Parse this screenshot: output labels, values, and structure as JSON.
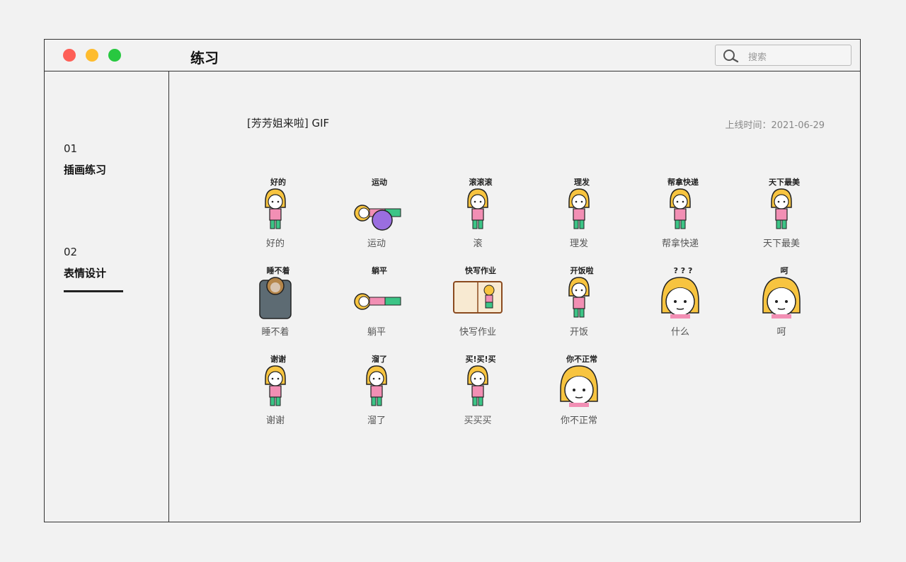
{
  "window": {
    "title": "练习",
    "search_placeholder": "搜索"
  },
  "sidebar": {
    "items": [
      {
        "num": "01",
        "label": "插画练习"
      },
      {
        "num": "02",
        "label": "表情设计"
      }
    ]
  },
  "content": {
    "title": "[芳芳姐来啦]  GIF",
    "date": "上线时间：2021-06-29",
    "stickers": [
      {
        "caption": "好的",
        "label": "好的",
        "icon": "ok-sticker-icon"
      },
      {
        "caption": "运动",
        "label": "运动",
        "icon": "exercise-sticker-icon"
      },
      {
        "caption": "滚滚滚",
        "label": "滚",
        "icon": "go-away-sticker-icon"
      },
      {
        "caption": "理发",
        "label": "理发",
        "icon": "haircut-sticker-icon"
      },
      {
        "caption": "帮拿快递",
        "label": "帮拿快递",
        "icon": "delivery-sticker-icon"
      },
      {
        "caption": "天下最美",
        "label": "天下最美",
        "icon": "most-beautiful-sticker-icon"
      },
      {
        "caption": "睡不着",
        "label": "睡不着",
        "icon": "cant-sleep-sticker-icon"
      },
      {
        "caption": "躺平",
        "label": "躺平",
        "icon": "lie-flat-sticker-icon"
      },
      {
        "caption": "快写作业",
        "label": "快写作业",
        "icon": "homework-sticker-icon"
      },
      {
        "caption": "开饭啦",
        "label": "开饭",
        "icon": "dinner-sticker-icon"
      },
      {
        "caption": "? ? ?",
        "label": "什么",
        "icon": "what-sticker-icon"
      },
      {
        "caption": "呵",
        "label": "呵",
        "icon": "heh-sticker-icon"
      },
      {
        "caption": "谢谢",
        "label": "谢谢",
        "icon": "thanks-sticker-icon"
      },
      {
        "caption": "溜了",
        "label": "溜了",
        "icon": "leaving-sticker-icon"
      },
      {
        "caption": "买!买!买",
        "label": "买买买",
        "icon": "shopping-sticker-icon"
      },
      {
        "caption": "你不正常",
        "label": "你不正常",
        "icon": "not-normal-sticker-icon"
      }
    ]
  },
  "colors": {
    "hair": "#f7c440",
    "shirt": "#f28fb4",
    "pants": "#3cc486",
    "outline": "#222222",
    "close": "#fe5f57",
    "minimize": "#febc2e",
    "zoom": "#28c840"
  }
}
